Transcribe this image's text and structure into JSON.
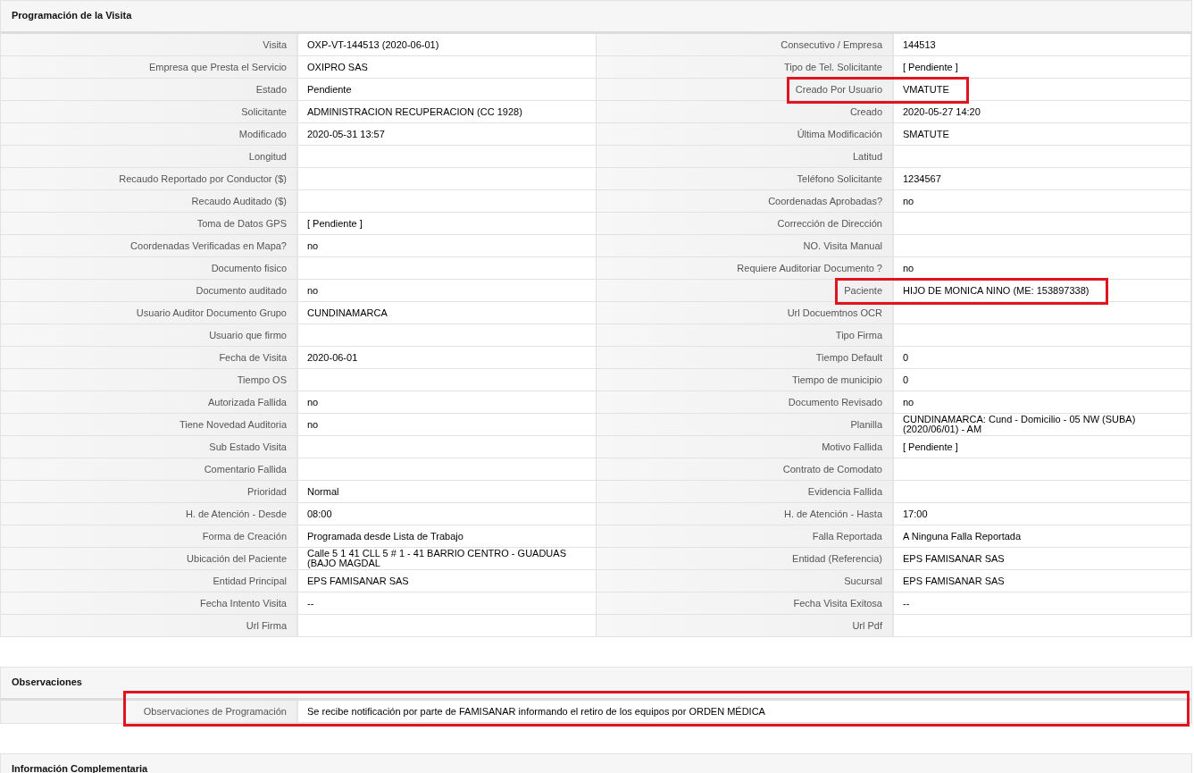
{
  "sections": [
    {
      "title": "Programación de la Visita",
      "kind": "grid",
      "rows": [
        {
          "left": {
            "label": "Visita",
            "value": "OXP-VT-144513 (2020-06-01)",
            "highlighted": false
          },
          "right": {
            "label": "Consecutivo / Empresa",
            "value": "144513",
            "highlighted": false
          }
        },
        {
          "left": {
            "label": "Empresa que Presta el Servicio",
            "value": "OXIPRO SAS",
            "highlighted": false
          },
          "right": {
            "label": "Tipo de Tel. Solicitante",
            "value": "[ Pendiente ]",
            "highlighted": false
          }
        },
        {
          "left": {
            "label": "Estado",
            "value": "Pendiente",
            "highlighted": false
          },
          "right": {
            "label": "Creado Por Usuario",
            "value": "VMATUTE",
            "highlighted": true
          }
        },
        {
          "left": {
            "label": "Solicitante",
            "value": "ADMINISTRACION RECUPERACION (CC 1928)",
            "highlighted": false
          },
          "right": {
            "label": "Creado",
            "value": "2020-05-27 14:20",
            "highlighted": false
          }
        },
        {
          "left": {
            "label": "Modificado",
            "value": "2020-05-31 13:57",
            "highlighted": false
          },
          "right": {
            "label": "Última Modificación",
            "value": "SMATUTE",
            "highlighted": false
          }
        },
        {
          "left": {
            "label": "Longitud",
            "highlighted": false
          },
          "right": {
            "label": "Latitud",
            "highlighted": false
          }
        },
        {
          "left": {
            "label": "Recaudo Reportado por Conductor ($)",
            "highlighted": false
          },
          "right": {
            "label": "Teléfono Solicitante",
            "value": "1234567",
            "highlighted": false
          }
        },
        {
          "left": {
            "label": "Recaudo Auditado ($)",
            "highlighted": false
          },
          "right": {
            "label": "Coordenadas Aprobadas?",
            "value": "no",
            "highlighted": false
          }
        },
        {
          "left": {
            "label": "Toma de Datos GPS",
            "value": "[ Pendiente ]",
            "highlighted": false
          },
          "right": {
            "label": "Corrección de Dirección",
            "highlighted": false
          }
        },
        {
          "left": {
            "label": "Coordenadas Verificadas en Mapa?",
            "value": "no",
            "highlighted": false
          },
          "right": {
            "label": "NO. Visita Manual",
            "highlighted": false
          }
        },
        {
          "left": {
            "label": "Documento fisico",
            "highlighted": false
          },
          "right": {
            "label": "Requiere Auditoriar Documento ?",
            "value": "no",
            "highlighted": false
          }
        },
        {
          "left": {
            "label": "Documento auditado",
            "value": "no",
            "highlighted": false
          },
          "right": {
            "label": "Paciente",
            "value": "HIJO DE MONICA NINO (ME: 153897338)",
            "highlighted": true
          }
        },
        {
          "left": {
            "label": "Usuario Auditor Documento Grupo",
            "value": "CUNDINAMARCA",
            "highlighted": false
          },
          "right": {
            "label": "Url Docuemtnos OCR",
            "highlighted": false
          }
        },
        {
          "left": {
            "label": "Usuario que firmo",
            "highlighted": false
          },
          "right": {
            "label": "Tipo Firma",
            "highlighted": false
          }
        },
        {
          "left": {
            "label": "Fecha de Visita",
            "value": "2020-06-01",
            "highlighted": false
          },
          "right": {
            "label": "Tiempo Default",
            "value": "0",
            "highlighted": false
          }
        },
        {
          "left": {
            "label": "Tiempo OS",
            "highlighted": false
          },
          "right": {
            "label": "Tiempo de municipio",
            "value": "0",
            "highlighted": false
          }
        },
        {
          "left": {
            "label": "Autorizada Fallida",
            "value": "no",
            "highlighted": false
          },
          "right": {
            "label": "Documento Revisado",
            "value": "no",
            "highlighted": false
          }
        },
        {
          "left": {
            "label": "Tiene Novedad Auditoria",
            "value": "no",
            "highlighted": false
          },
          "right": {
            "label": "Planilla",
            "value": "CUNDINAMARCA: Cund - Domicilio - 05 NW (SUBA) (2020/06/01) - AM",
            "highlighted": false
          }
        },
        {
          "left": {
            "label": "Sub Estado Visita",
            "highlighted": false
          },
          "right": {
            "label": "Motivo Fallida",
            "value": "[ Pendiente ]",
            "highlighted": false
          }
        },
        {
          "left": {
            "label": "Comentario Fallida",
            "highlighted": false
          },
          "right": {
            "label": "Contrato de Comodato",
            "highlighted": false
          }
        },
        {
          "left": {
            "label": "Prioridad",
            "value": "Normal",
            "highlighted": false
          },
          "right": {
            "label": "Evidencia Fallida",
            "highlighted": false
          }
        },
        {
          "left": {
            "label": "H. de Atención - Desde",
            "value": "08:00",
            "highlighted": false
          },
          "right": {
            "label": "H. de Atención - Hasta",
            "value": "17:00",
            "highlighted": false
          }
        },
        {
          "left": {
            "label": "Forma de Creación",
            "value": "Programada desde Lista de Trabajo",
            "highlighted": false
          },
          "right": {
            "label": "Falla Reportada",
            "value": "A Ninguna Falla Reportada",
            "highlighted": false
          }
        },
        {
          "left": {
            "label": "Ubicación del Paciente",
            "value": "Calle 5 1 41 CLL 5 # 1 - 41 BARRIO CENTRO - GUADUAS (BAJO MAGDAL",
            "highlighted": false
          },
          "right": {
            "label": "Entidad (Referencia)",
            "value": "EPS FAMISANAR SAS",
            "highlighted": false
          }
        },
        {
          "left": {
            "label": "Entidad Principal",
            "value": "EPS FAMISANAR SAS",
            "highlighted": false
          },
          "right": {
            "label": "Sucursal",
            "value": "EPS FAMISANAR SAS",
            "highlighted": false
          }
        },
        {
          "left": {
            "label": "Fecha Intento Visita",
            "value": "--",
            "highlighted": false
          },
          "right": {
            "label": "Fecha Visita Exitosa",
            "value": "--",
            "highlighted": false
          }
        },
        {
          "left": {
            "label": "Url Firma",
            "highlighted": false
          },
          "right": {
            "label": "Url Pdf",
            "highlighted": false
          }
        }
      ]
    },
    {
      "title": "Observaciones",
      "kind": "notes",
      "fields": [
        {
          "label": "Observaciones de Programación",
          "value": "Se recibe notificación por parte de FAMISANAR informando el retiro de los equipos por ORDEN MÉDICA",
          "highlighted": true
        }
      ]
    },
    {
      "title": "Información Complementaria",
      "kind": "header"
    }
  ]
}
